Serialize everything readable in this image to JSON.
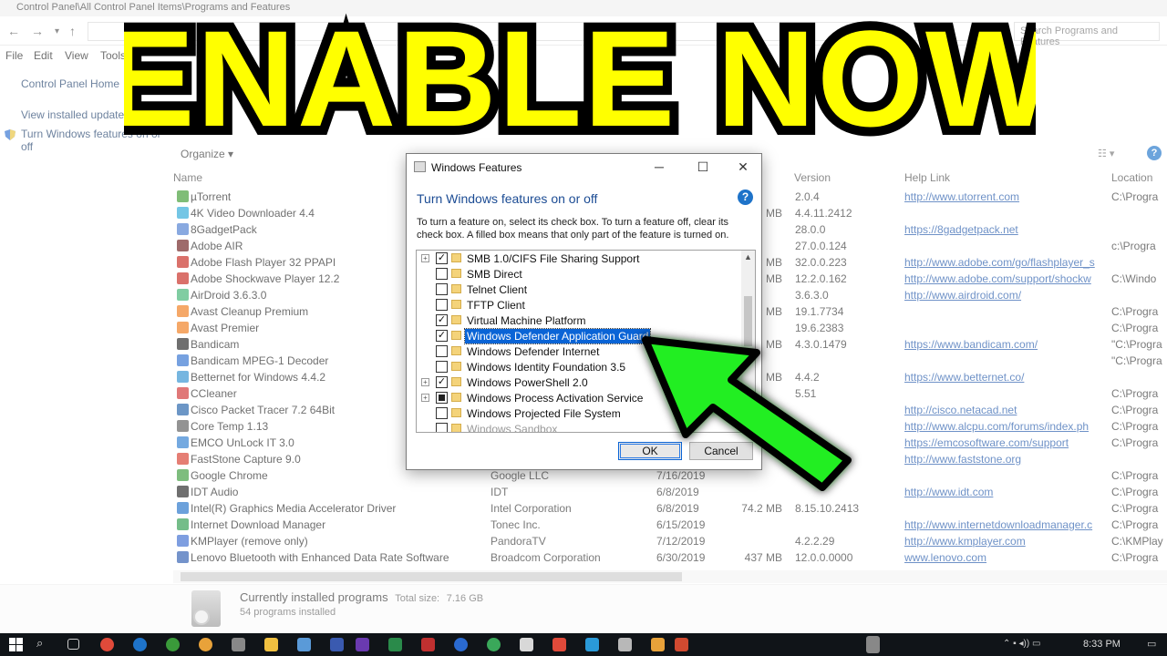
{
  "window": {
    "title": "Control Panel\\All Control Panel Items\\Programs and Features",
    "address": "Control Panel\\All Control Panel Items\\Programs and Features",
    "search_placeholder": "Search Programs and Features"
  },
  "menu": [
    "File",
    "Edit",
    "View",
    "Tools"
  ],
  "sidebar": {
    "home": "Control Panel Home",
    "updates": "View installed updates",
    "features_line1": "Turn Windows features on or",
    "features_line2": "off"
  },
  "toolbar": {
    "organize": "Organize"
  },
  "columns": {
    "name": "Name",
    "version": "Version",
    "help_link": "Help Link",
    "location": "Location"
  },
  "programs": [
    {
      "name": "µTorrent",
      "publisher": "",
      "date": "",
      "size": "",
      "version": "2.0.4",
      "help": "http://www.utorrent.com",
      "location": "C:\\Progra",
      "color": "#3c9a2f"
    },
    {
      "name": "4K Video Downloader 4.4",
      "publisher": "",
      "date": "",
      "size": "MB",
      "version": "4.4.11.2412",
      "help": "",
      "location": "",
      "color": "#2aa8d8"
    },
    {
      "name": "8GadgetPack",
      "publisher": "",
      "date": "",
      "size": "",
      "version": "28.0.0",
      "help": "https://8gadgetpack.net",
      "location": "",
      "color": "#4a7bd0"
    },
    {
      "name": "Adobe AIR",
      "publisher": "",
      "date": "",
      "size": "",
      "version": "27.0.0.124",
      "help": "",
      "location": "c:\\Progra",
      "color": "#6a1b1b"
    },
    {
      "name": "Adobe Flash Player 32 PPAPI",
      "publisher": "",
      "date": "",
      "size": "MB",
      "version": "32.0.0.223",
      "help": "http://www.adobe.com/go/flashplayer_s",
      "location": "",
      "color": "#c7261c"
    },
    {
      "name": "Adobe Shockwave Player 12.2",
      "publisher": "",
      "date": "",
      "size": "MB",
      "version": "12.2.0.162",
      "help": "http://www.adobe.com/support/shockw",
      "location": "C:\\Windo",
      "color": "#c7261c"
    },
    {
      "name": "AirDroid 3.6.3.0",
      "publisher": "",
      "date": "",
      "size": "",
      "version": "3.6.3.0",
      "help": "http://www.airdroid.com/",
      "location": "",
      "color": "#3cb371"
    },
    {
      "name": "Avast Cleanup Premium",
      "publisher": "",
      "date": "",
      "size": "MB",
      "version": "19.1.7734",
      "help": "",
      "location": "C:\\Progra",
      "color": "#f07a18"
    },
    {
      "name": "Avast Premier",
      "publisher": "",
      "date": "",
      "size": "",
      "version": "19.6.2383",
      "help": "",
      "location": "C:\\Progra",
      "color": "#f07a18"
    },
    {
      "name": "Bandicam",
      "publisher": "",
      "date": "",
      "size": "MB",
      "version": "4.3.0.1479",
      "help": "https://www.bandicam.com/",
      "location": "\"C:\\Progra",
      "color": "#222"
    },
    {
      "name": "Bandicam MPEG-1 Decoder",
      "publisher": "",
      "date": "",
      "size": "",
      "version": "",
      "help": "",
      "location": "\"C:\\Progra",
      "color": "#2d6fd0"
    },
    {
      "name": "Betternet for Windows 4.4.2",
      "publisher": "",
      "date": "",
      "size": "MB",
      "version": "4.4.2",
      "help": "https://www.betternet.co/",
      "location": "",
      "color": "#2d8fd0"
    },
    {
      "name": "CCleaner",
      "publisher": "",
      "date": "",
      "size": "",
      "version": "5.51",
      "help": "",
      "location": "C:\\Progra",
      "color": "#d03030"
    },
    {
      "name": "Cisco Packet Tracer 7.2 64Bit",
      "publisher": "",
      "date": "",
      "size": "",
      "version": "",
      "help": "http://cisco.netacad.net",
      "location": "C:\\Progra",
      "color": "#1e5fa8"
    },
    {
      "name": "Core Temp 1.13",
      "publisher": "",
      "date": "",
      "size": "",
      "version": "",
      "help": "http://www.alcpu.com/forums/index.ph",
      "location": "C:\\Progra",
      "color": "#5a5a5a"
    },
    {
      "name": "EMCO UnLock IT 3.0",
      "publisher": "",
      "date": "",
      "size": "",
      "version": "",
      "help": "https://emcosoftware.com/support",
      "location": "C:\\Progra",
      "color": "#2a7bd0"
    },
    {
      "name": "FastStone Capture 9.0",
      "publisher": "",
      "date": "",
      "size": "",
      "version": "",
      "help": "http://www.faststone.org",
      "location": "",
      "color": "#d83a2a"
    },
    {
      "name": "Google Chrome",
      "publisher": "Google LLC",
      "date": "7/16/2019",
      "size": "",
      "version": "",
      "help": "",
      "location": "C:\\Progra",
      "color": "#3a9a3a"
    },
    {
      "name": "IDT Audio",
      "publisher": "IDT",
      "date": "6/8/2019",
      "size": "",
      "version": "",
      "help": "http://www.idt.com",
      "location": "C:\\Progra",
      "color": "#222"
    },
    {
      "name": "Intel(R) Graphics Media Accelerator Driver",
      "publisher": "Intel Corporation",
      "date": "6/8/2019",
      "size": "74.2 MB",
      "version": "8.15.10.2413",
      "help": "",
      "location": "C:\\Progra",
      "color": "#1e6fc8"
    },
    {
      "name": "Internet Download Manager",
      "publisher": "Tonec Inc.",
      "date": "6/15/2019",
      "size": "",
      "version": "",
      "help": "http://www.internetdownloadmanager.c",
      "location": "C:\\Progra",
      "color": "#2a9a4a"
    },
    {
      "name": "KMPlayer (remove only)",
      "publisher": "PandoraTV",
      "date": "7/12/2019",
      "size": "",
      "version": "4.2.2.29",
      "help": "http://www.kmplayer.com",
      "location": "C:\\KMPlay",
      "color": "#3a6ad0"
    },
    {
      "name": "Lenovo Bluetooth with Enhanced Data Rate Software",
      "publisher": "Broadcom Corporation",
      "date": "6/30/2019",
      "size": "437 MB",
      "version": "12.0.0.0000",
      "help": "www.lenovo.com",
      "location": "C:\\Progra",
      "color": "#2a5ab0"
    }
  ],
  "status": {
    "line1": "Currently installed programs",
    "total_label": "Total size:",
    "total_value": "7.16 GB",
    "line2": "54 programs installed"
  },
  "dialog": {
    "title": "Windows Features",
    "heading": "Turn Windows features on or off",
    "description": "To turn a feature on, select its check box. To turn a feature off, clear its check box. A filled box means that only part of the feature is turned on.",
    "ok": "OK",
    "cancel": "Cancel",
    "features": [
      {
        "label": "SMB 1.0/CIFS File Sharing Support",
        "state": "checked",
        "expandable": true
      },
      {
        "label": "SMB Direct",
        "state": "unchecked",
        "expandable": false
      },
      {
        "label": "Telnet Client",
        "state": "unchecked",
        "expandable": false
      },
      {
        "label": "TFTP Client",
        "state": "unchecked",
        "expandable": false
      },
      {
        "label": "Virtual Machine Platform",
        "state": "checked",
        "expandable": false
      },
      {
        "label": "Windows Defender Application Guard",
        "state": "checked",
        "expandable": false,
        "selected": true
      },
      {
        "label": "Windows Defender Internet",
        "state": "unchecked",
        "expandable": false
      },
      {
        "label": "Windows Identity Foundation 3.5",
        "state": "unchecked",
        "expandable": false
      },
      {
        "label": "Windows PowerShell 2.0",
        "state": "checked",
        "expandable": true
      },
      {
        "label": "Windows Process Activation Service",
        "state": "partial",
        "expandable": true
      },
      {
        "label": "Windows Projected File System",
        "state": "unchecked",
        "expandable": false
      },
      {
        "label": "Windows Sandbox",
        "state": "unchecked",
        "expandable": false,
        "faded": true
      }
    ]
  },
  "banner": {
    "text": "ENABLE NOW",
    "color": "#ffff00"
  },
  "arrow": {
    "color": "#22ee22"
  },
  "taskbar": {
    "time": "8:33 PM"
  }
}
